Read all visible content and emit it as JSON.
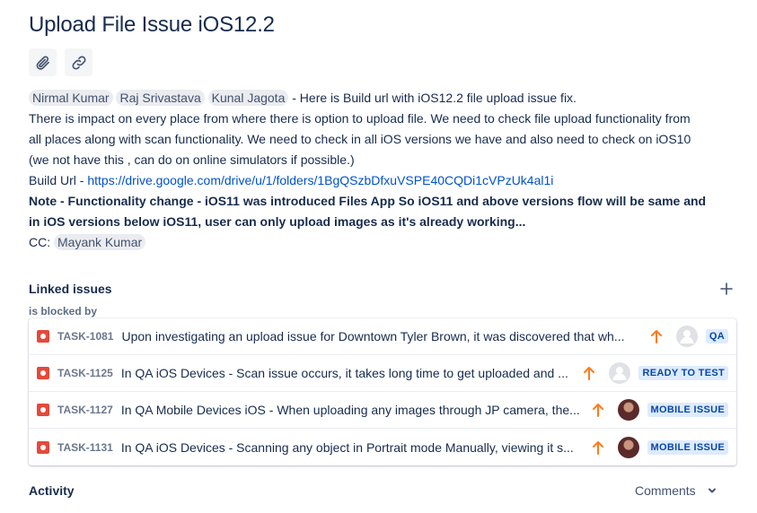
{
  "issue": {
    "title": "Upload File Issue iOS12.2"
  },
  "toolbar": {
    "attach_icon": "paperclip-icon",
    "link_icon": "link-icon"
  },
  "description": {
    "mentions_line1": [
      "Nirmal Kumar",
      "Raj Srivastava",
      "Kunal Jagota"
    ],
    "line1_text": " - Here is Build url with iOS12.2 file upload issue fix.",
    "line2": "There is impact on every place from where there is option to upload file. We need to check file upload functionality from",
    "line3": "all places along with scan functionality. We need to check in all iOS versions we have and also need to check on iOS10",
    "line4": "(we not have this , can do on online simulators if possible.)",
    "build_prefix": "Build Url - ",
    "build_url": "https://drive.google.com/drive/u/1/folders/1BgQSzbDfxuVSPE40CQDi1cVPzUk4al1i",
    "note_line1": "Note - Functionality change - iOS11 was introduced Files App So iOS11 and above versions flow will be same and",
    "note_line2": "in iOS versions below iOS11, user can only upload images as it's already working...",
    "cc_label": "CC: ",
    "cc_mention": "Mayank Kumar"
  },
  "linked_issues": {
    "title": "Linked issues",
    "relation": "is blocked by",
    "items": [
      {
        "key": "TASK-1081",
        "summary": "Upon investigating an upload issue for Downtown Tyler Brown, it was discovered that wh...",
        "priority_icon": "priority-high-icon",
        "avatar": "default",
        "status": "QA"
      },
      {
        "key": "TASK-1125",
        "summary": "In QA iOS Devices - Scan issue occurs, it takes long time to get uploaded and ...",
        "priority_icon": "priority-high-icon",
        "avatar": "default",
        "status": "READY TO TEST"
      },
      {
        "key": "TASK-1127",
        "summary": "In QA Mobile Devices iOS - When uploading any images through JP camera, the...",
        "priority_icon": "priority-high-icon",
        "avatar": "photo",
        "status": "MOBILE ISSUE"
      },
      {
        "key": "TASK-1131",
        "summary": "In QA iOS Devices - Scanning any object in Portrait mode Manually, viewing it s...",
        "priority_icon": "priority-high-icon",
        "avatar": "photo",
        "status": "MOBILE ISSUE"
      }
    ]
  },
  "activity": {
    "title": "Activity",
    "filter_value": "Comments"
  },
  "colors": {
    "accent": "#0052cc",
    "priority": "#ff7a1a",
    "bug": "#e5493a",
    "status_bg": "#deebff",
    "status_text": "#0747a6"
  }
}
